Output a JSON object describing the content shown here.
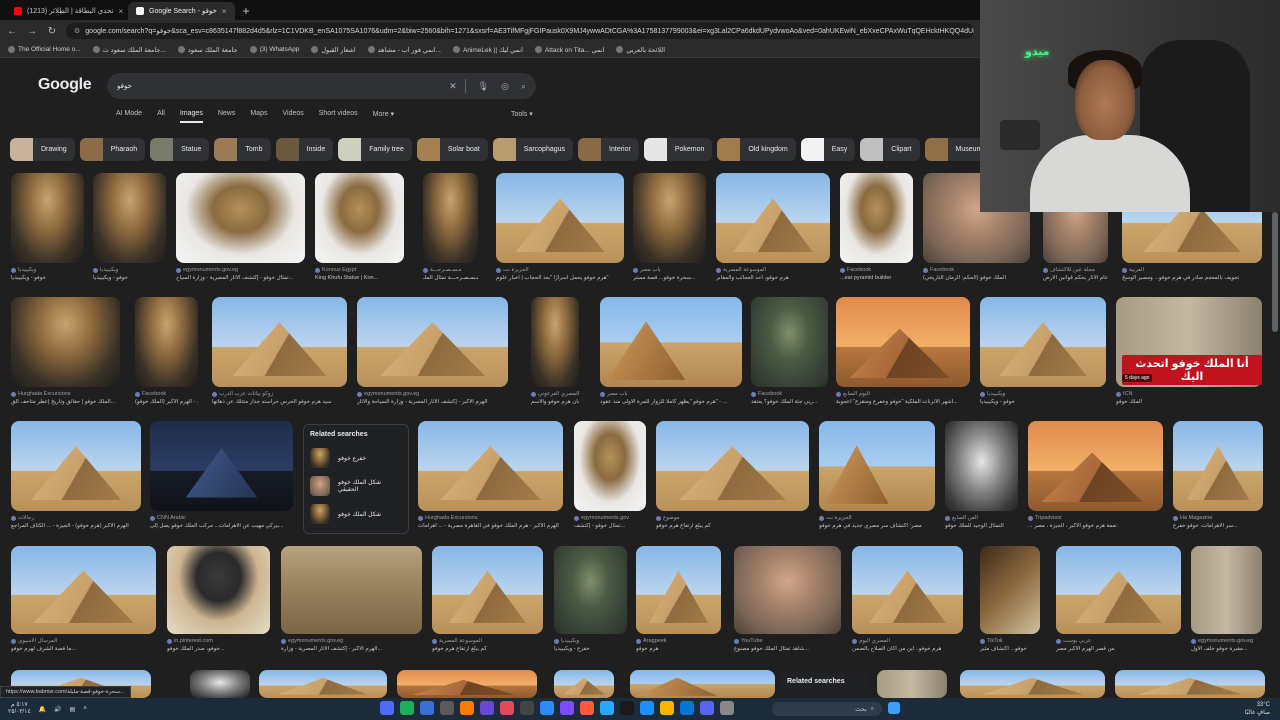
{
  "browser": {
    "tabs": [
      {
        "label": "(1213) تحدي البطاقة | الطلائر",
        "color": "#ff0000"
      },
      {
        "label": "Google Search - خوفو",
        "color": "#ffffff",
        "active": true
      }
    ],
    "new_tab_label": "+",
    "url": "google.com/search?q=خوفو&sca_esv=c8635147f882d4d5&rlz=1C1VDKB_enSA1075SA1076&udm=2&biw=2560&bih=1271&sxsrf=AE3TifMFgjFGIPausk0X9MJ4ywwADtCGA%3A1758137799003&ei=xg3Lal2CPa6dkdUPydvwoAo&ved=0ahUKEwiN_ebXxeCPAxWuTqQEHcktHKQQ4dUDCBE&uact",
    "bookmarks": [
      "The Official Home o...",
      "جامعة الملك سعود ت...",
      "جامعة الملك سعود",
      "(3) WhatsApp",
      "اشعار القبول",
      "انمي فور اب - مشاهد...",
      "AnimeLek || انمي ليك",
      "Attack on Tita... انمي",
      "اللائحة بالعربي"
    ]
  },
  "google": {
    "logo": "Google",
    "query": "خوفو",
    "tabs": [
      "AI Mode",
      "All",
      "Images",
      "News",
      "Maps",
      "Videos",
      "Short videos",
      "More ▾"
    ],
    "active_tab": "Images",
    "tools_label": "Tools ▾",
    "chips": [
      {
        "label": "Drawing",
        "color": "#c9b29a"
      },
      {
        "label": "Pharaoh",
        "color": "#8c6b47"
      },
      {
        "label": "Statue",
        "color": "#7a7a6a"
      },
      {
        "label": "Tomb",
        "color": "#9b7b55"
      },
      {
        "label": "Inside",
        "color": "#6a5840"
      },
      {
        "label": "Family tree",
        "color": "#cfcfc0"
      },
      {
        "label": "Solar boat",
        "color": "#a58052"
      },
      {
        "label": "Sarcophagus",
        "color": "#b89c70"
      },
      {
        "label": "Interior",
        "color": "#8a6a45"
      },
      {
        "label": "Pokemon",
        "color": "#e6e6e6"
      },
      {
        "label": "Old kingdom",
        "color": "#a07b4d"
      },
      {
        "label": "Easy",
        "color": "#f2f2f2"
      },
      {
        "label": "Clipart",
        "color": "#bfbfbf"
      },
      {
        "label": "Museum",
        "color": "#8e6f48"
      }
    ]
  },
  "results": {
    "row1": [
      {
        "src": "ويكيبيديا",
        "cap": "خوفو - ويكيبيديا"
      },
      {
        "src": "ويكيبيديا",
        "cap": "خوفو - ويكيبيديا"
      },
      {
        "src": "egymonuments.gov.eg",
        "cap": "تمثال خوفو - إكتشف الآثار المصرية - وزارة السياح..."
      },
      {
        "src": "Konouz Egypt",
        "cap": "King Khufu Statue | Kon..."
      },
      {
        "src": "مـسـصـرحـــة",
        "cap": "مـسـصـرحـــة تمثال الملـ..."
      },
      {
        "src": "الجزيرة نت",
        "cap": "هرم خوفو يحمل أسرارًا \"بعد الحجاب | أخبار علوم\""
      },
      {
        "src": "باب مصر",
        "cap": "سحرة خوفو... قصة مستر..."
      },
      {
        "src": "الموسوعة المصرية",
        "cap": "هرم خوفو، أحد العجائب والمقابر"
      },
      {
        "src": "Facebook",
        "cap": "...eat pyramid builder"
      },
      {
        "src": "Facebook",
        "cap": "الملك خوفو (الحكم: الزمان التاريخي)"
      },
      {
        "src": "مجلة عين للاكتشاف",
        "cap": "دعام الآثار بحكم قوانين الارض"
      },
      {
        "src": "العربية",
        "cap": "تجويف بالمعجم صادر في هرم خوفو... ومصير الوسخ"
      }
    ],
    "row2": [
      {
        "src": "Hurghada Excursions",
        "cap": "الملك خوفو | حقائق وتاريخ إعطر متاحف الق..."
      },
      {
        "src": "Facebook",
        "cap": "الهرم الأكبر (الملك خوفو) - ..."
      },
      {
        "src": "زوكو بيانات عرب الدرب",
        "cap": "سيد هرم خوفو الحرس حراسته جدار متتلك عن ذهاتها"
      },
      {
        "src": "egymonuments.gov.eg",
        "cap": "الهرم الأكبر - إكتشف الآثار المصرية - وزارة السياحة والآثار"
      },
      {
        "src": "التاريخ المصري الفرعوني",
        "cap": "من لجان هرم خوفو والاسم..."
      },
      {
        "src": "باب مصر",
        "cap": "هرم خوفو \"يظهر كاملا للزوار للمرة الأولى منذ عقود\" - ..."
      },
      {
        "src": "Facebook",
        "cap": "ربي جثة الملك خوفو؟ يعتقد..."
      },
      {
        "src": "اليوم السابع",
        "cap": "أشهر الآثرنات الملكية \"خوفو وخفرع ومنقرع\" أعجوبة..."
      },
      {
        "src": "ويكيبيديا",
        "cap": "خوفو - ويكيبيديا"
      },
      {
        "src": "ICN",
        "cap": "الملك خوفو"
      }
    ],
    "overlay_text": "أنا الملك خوفو اتحدث اليك",
    "overlay_badge": "5 days ago",
    "row3": [
      {
        "src": "رحالات",
        "cap": "الهرم الأكبر (هرم خوفو) - الجيزة - ... الكثاف المراجع"
      },
      {
        "src": "CNN Arabic",
        "cap": "بيركي مهيب عن الأهرامات... مركب الملك خوفو يصل إلى..."
      },
      {
        "src": "Hurghada Excursions",
        "cap": "الهرم الأكبر - هرم الملك خوفو في القاهرة مصرية - ... أهرامات"
      },
      {
        "src": "egymonuments.gov",
        "cap": "تمثال خوفو - إكتشف..."
      },
      {
        "src": "موضوع",
        "cap": "كم يبلغ ارتفاع هرم خوفو"
      },
      {
        "src": "الجزيرة نت",
        "cap": "مصر: اكتشاف سر مصري جديد في هرم خوفو"
      },
      {
        "src": "الفن السابع",
        "cap": "التمثال الوحيد للملك خوفو"
      },
      {
        "src": "Tripadvisor",
        "cap": "... نعمة هرم خوفو الأكبر ، الجيزة ، مصر"
      },
      {
        "src": "Ha Magazine",
        "cap": "سر الأهرامات، خوفو خفرع..."
      }
    ],
    "related": {
      "title": "Related searches",
      "items": [
        "خفرع خوفو",
        "شكل الملك خوفو الحقيقي",
        "شكل الملك خوفو"
      ]
    },
    "row4": [
      {
        "src": "المرسال الأسيوي",
        "cap": "ما قصة الشرف لهرم خوفو..."
      },
      {
        "src": "in.pinterest.com",
        "cap": "خوفو، صدر الملك خوفو..."
      },
      {
        "src": "egymonuments.gov.eg",
        "cap": "الهرم الأكبر - إكتشف الآثار المصرية - وزارة..."
      },
      {
        "src": "الموسوعة المصرية",
        "cap": "كم يبلغ ارتفاع هرم خوفو"
      },
      {
        "src": "ويكيبيديا",
        "cap": "خفرع - ويكيبيديا"
      },
      {
        "src": "Aragpeek",
        "cap": "هرم خوفو"
      },
      {
        "src": "YouTube",
        "cap": "شاهد تمثال الملك خوفو مصنوع..."
      },
      {
        "src": "المصري اليوم",
        "cap": "هرم خوفو.. أين من أكان الصلاح بالصمن"
      },
      {
        "src": "TikTok",
        "cap": "خوفو... اكتشاف مثير"
      },
      {
        "src": "عربي بوست",
        "cap": "من قصر الهرم الأكبر مصر"
      },
      {
        "src": "egymonuments.gov.eg",
        "cap": "مقبرة خوفو خلف الأول..."
      }
    ],
    "related_bottom": "Related searches"
  },
  "webcam": {
    "neon_text": "ميدو"
  },
  "taskbar": {
    "search_placeholder": "بحث",
    "time": "33°C",
    "weather": "صافٍ غالبًا",
    "left_time": "٥:١٧ م",
    "left_date": "٢٥/٠٣/١٤"
  },
  "status_url": "https://www.babmsr.com/سحرة-خوفو-قصة-مليلة..."
}
